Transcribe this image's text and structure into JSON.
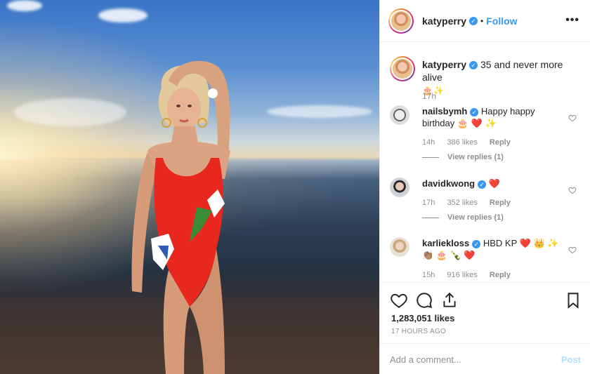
{
  "post": {
    "author": "katyperry",
    "follow_label": "Follow",
    "dot": "•",
    "more_label": "•••",
    "caption_text": "35 and never more alive",
    "caption_emojis": [
      "🎂",
      "✨"
    ],
    "caption_time": "17h"
  },
  "comments": [
    {
      "user": "nailsbymh",
      "text": "Happy happy birthday",
      "emoji_suffix": "🎂 ❤️ ✨",
      "time": "14h",
      "likes": "386 likes",
      "reply_label": "Reply",
      "view_replies": "View replies (1)"
    },
    {
      "user": "davidkwong",
      "text": "",
      "emoji_suffix": "❤️",
      "time": "17h",
      "likes": "352 likes",
      "reply_label": "Reply",
      "view_replies": "View replies (1)"
    },
    {
      "user": "karliekloss",
      "text": "HBD KP",
      "emoji_suffix": "❤️ 👑 ✨ 👏🏽 🎂 🍾 ❤️",
      "time": "15h",
      "likes": "916 likes",
      "reply_label": "Reply"
    }
  ],
  "actions": {
    "likes_count": "1,283,051 likes",
    "timestamp": "17 HOURS AGO",
    "comment_placeholder": "Add a comment...",
    "post_label": "Post"
  },
  "colors": {
    "accent": "#3897f0",
    "heart_red": "#ed4956",
    "muted": "#8e8e8e",
    "post_disabled": "#b2dffc"
  }
}
